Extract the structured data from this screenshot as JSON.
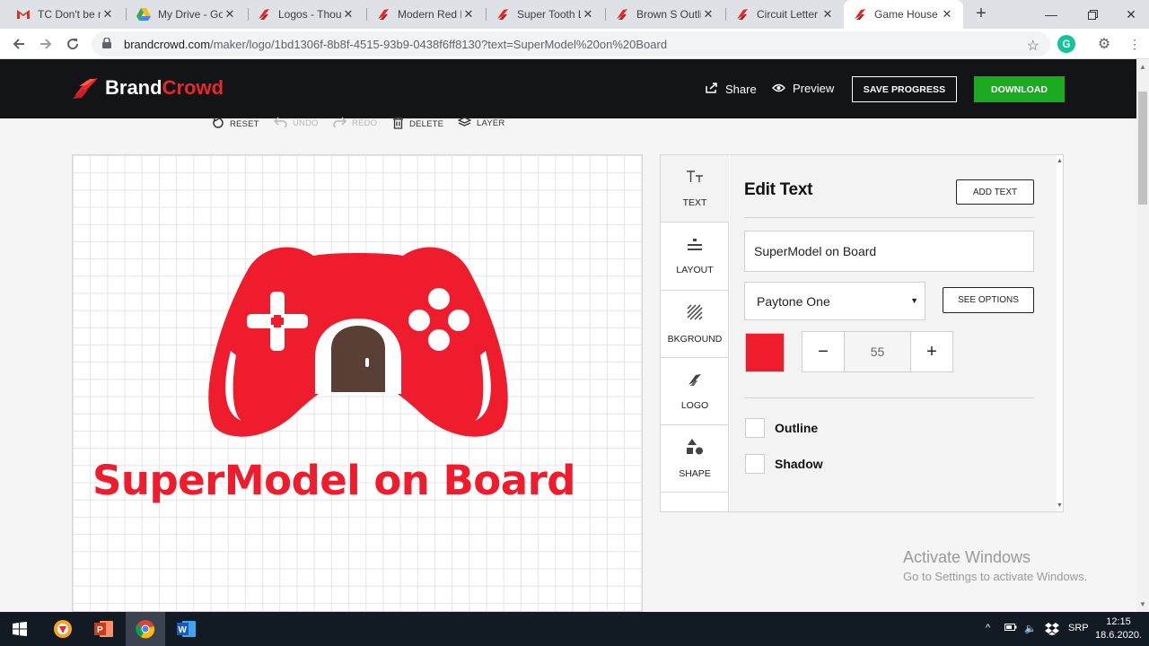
{
  "browser": {
    "tabs": [
      {
        "title": "TC Don't be m",
        "favicon": "gmail-icon"
      },
      {
        "title": "My Drive - Goo",
        "favicon": "google-drive-icon"
      },
      {
        "title": "Logos - Thous",
        "favicon": "brandcrowd-icon"
      },
      {
        "title": "Modern Red Lo",
        "favicon": "brandcrowd-icon"
      },
      {
        "title": "Super Tooth Lo",
        "favicon": "brandcrowd-icon"
      },
      {
        "title": "Brown S Outlin",
        "favicon": "brandcrowd-icon"
      },
      {
        "title": "Circuit Letter S",
        "favicon": "brandcrowd-icon"
      },
      {
        "title": "Game House L",
        "favicon": "brandcrowd-icon"
      }
    ],
    "url_domain": "brandcrowd.com",
    "url_path": "/maker/logo/1bd1306f-8b8f-4515-93b9-0438f6ff8130?text=SuperModel%20on%20Board"
  },
  "header": {
    "logo_brand": "Brand",
    "logo_crowd": "Crowd",
    "share_label": "Share",
    "preview_label": "Preview",
    "save_label": "SAVE PROGRESS",
    "download_label": "DOWNLOAD"
  },
  "edit_toolbar": {
    "reset": "RESET",
    "undo": "UNDO",
    "redo": "REDO",
    "delete": "DELETE",
    "layer": "LAYER"
  },
  "canvas": {
    "logo_text": "SuperModel on Board",
    "logo_color": "#ee1c2c",
    "door_color": "#5a3f37"
  },
  "panel": {
    "tabs": [
      {
        "label": "TEXT",
        "icon": "text-icon"
      },
      {
        "label": "LAYOUT",
        "icon": "layout-icon"
      },
      {
        "label": "BKGROUND",
        "icon": "background-icon"
      },
      {
        "label": "LOGO",
        "icon": "logo-icon"
      },
      {
        "label": "SHAPE",
        "icon": "shape-icon"
      }
    ],
    "title": "Edit Text",
    "add_text_label": "ADD TEXT",
    "text_value": "SuperModel on Board",
    "font_value": "Paytone One",
    "see_options_label": "SEE OPTIONS",
    "color": "#ee1c2c",
    "size_value": "55",
    "outline_label": "Outline",
    "shadow_label": "Shadow"
  },
  "watermark": {
    "line1": "Activate Windows",
    "line2": "Go to Settings to activate Windows."
  },
  "taskbar": {
    "language": "SRP",
    "time": "12:15",
    "date": "18.6.2020."
  }
}
